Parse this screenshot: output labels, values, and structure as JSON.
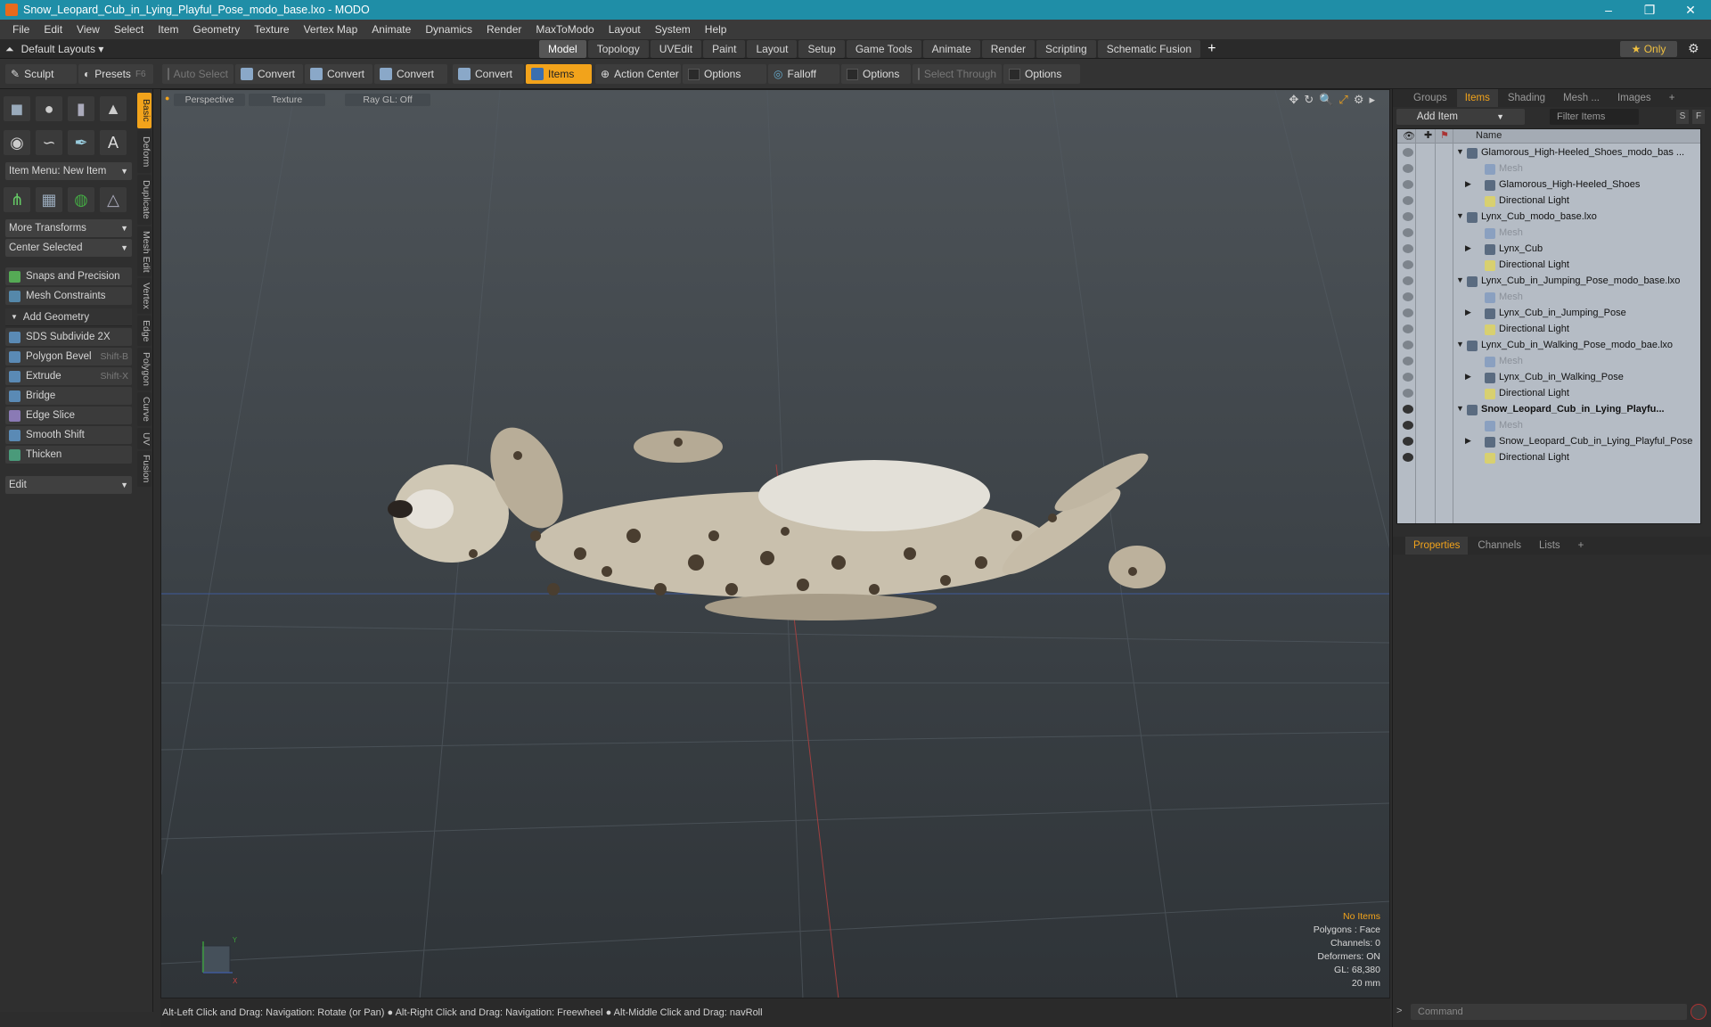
{
  "window": {
    "title": "Snow_Leopard_Cub_in_Lying_Playful_Pose_modo_base.lxo - MODO",
    "controls": [
      "–",
      "❐",
      "✕"
    ]
  },
  "menu": [
    "File",
    "Edit",
    "View",
    "Select",
    "Item",
    "Geometry",
    "Texture",
    "Vertex Map",
    "Animate",
    "Dynamics",
    "Render",
    "MaxToModo",
    "Layout",
    "System",
    "Help"
  ],
  "layout_menu": "Default Layouts ▾",
  "tabs": [
    "Model",
    "Topology",
    "UVEdit",
    "Paint",
    "Layout",
    "Setup",
    "Game Tools",
    "Animate",
    "Render",
    "Scripting",
    "Schematic Fusion"
  ],
  "active_tab": "Model",
  "only_label": "Only",
  "toolbar": {
    "sculpt": "Sculpt",
    "presets": "Presets",
    "presets_key": "F6",
    "auto_select": "Auto Select",
    "convert": "Convert",
    "items": "Items",
    "action_center": "Action Center",
    "options": "Options",
    "falloff": "Falloff",
    "select_through": "Select Through"
  },
  "left": {
    "item_menu": "Item Menu: New Item",
    "more_transforms": "More Transforms",
    "center_selected": "Center Selected",
    "snaps": "Snaps and Precision",
    "mesh_constraints": "Mesh Constraints",
    "add_geometry": "Add Geometry",
    "tools": [
      {
        "label": "SDS Subdivide 2X",
        "key": ""
      },
      {
        "label": "Polygon Bevel",
        "key": "Shift-B"
      },
      {
        "label": "Extrude",
        "key": "Shift-X"
      },
      {
        "label": "Bridge",
        "key": ""
      },
      {
        "label": "Edge Slice",
        "key": ""
      },
      {
        "label": "Smooth Shift",
        "key": ""
      },
      {
        "label": "Thicken",
        "key": ""
      }
    ],
    "edit": "Edit",
    "vtabs": [
      "Basic",
      "Deform",
      "Duplicate",
      "Mesh Edit",
      "Vertex",
      "Edge",
      "Polygon",
      "Curve",
      "UV",
      "Fusion"
    ]
  },
  "viewport": {
    "perspective": "Perspective",
    "texture": "Texture",
    "raygl": "Ray GL: Off",
    "info": {
      "no_items": "No Items",
      "polygons": "Polygons : Face",
      "channels": "Channels: 0",
      "deformers": "Deformers: ON",
      "gl": "GL: 68,380",
      "scale": "20 mm"
    }
  },
  "status": "Alt-Left Click and Drag: Navigation: Rotate (or Pan) ● Alt-Right Click and Drag: Navigation: Freewheel ● Alt-Middle Click and Drag: navRoll",
  "right": {
    "tabs": [
      "Groups",
      "Items",
      "Shading",
      "Mesh ...",
      "Images"
    ],
    "active_tab": "Items",
    "add_item": "Add Item",
    "filter": "Filter Items",
    "s": "S",
    "f": "F",
    "name_col": "Name",
    "rows": [
      {
        "label": "Glamorous_High-Heeled_Shoes_modo_bas ...",
        "indent": 0,
        "type": "scene"
      },
      {
        "label": "Mesh",
        "indent": 1,
        "type": "mesh"
      },
      {
        "label": "Glamorous_High-Heeled_Shoes",
        "indent": 1,
        "type": "group"
      },
      {
        "label": "Directional Light",
        "indent": 1,
        "type": "light"
      },
      {
        "label": "Lynx_Cub_modo_base.lxo",
        "indent": 0,
        "type": "scene"
      },
      {
        "label": "Mesh",
        "indent": 1,
        "type": "mesh"
      },
      {
        "label": "Lynx_Cub",
        "indent": 1,
        "type": "group"
      },
      {
        "label": "Directional Light",
        "indent": 1,
        "type": "light"
      },
      {
        "label": "Lynx_Cub_in_Jumping_Pose_modo_base.lxo",
        "indent": 0,
        "type": "scene"
      },
      {
        "label": "Mesh",
        "indent": 1,
        "type": "mesh"
      },
      {
        "label": "Lynx_Cub_in_Jumping_Pose",
        "indent": 1,
        "type": "group"
      },
      {
        "label": "Directional Light",
        "indent": 1,
        "type": "light"
      },
      {
        "label": "Lynx_Cub_in_Walking_Pose_modo_bae.lxo",
        "indent": 0,
        "type": "scene"
      },
      {
        "label": "Mesh",
        "indent": 1,
        "type": "mesh"
      },
      {
        "label": "Lynx_Cub_in_Walking_Pose",
        "indent": 1,
        "type": "group"
      },
      {
        "label": "Directional Light",
        "indent": 1,
        "type": "light"
      },
      {
        "label": "Snow_Leopard_Cub_in_Lying_Playfu...",
        "indent": 0,
        "type": "scene-active"
      },
      {
        "label": "Mesh",
        "indent": 1,
        "type": "mesh"
      },
      {
        "label": "Snow_Leopard_Cub_in_Lying_Playful_Pose",
        "indent": 1,
        "type": "group"
      },
      {
        "label": "Directional Light",
        "indent": 1,
        "type": "light"
      }
    ],
    "prop_tabs": [
      "Properties",
      "Channels",
      "Lists"
    ],
    "command": "Command"
  },
  "colors": {
    "accent": "#f2a31b",
    "title_bar": "#1f8ea7"
  }
}
